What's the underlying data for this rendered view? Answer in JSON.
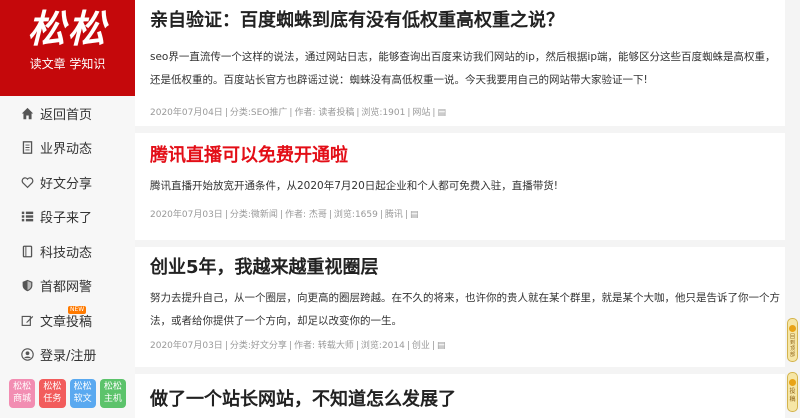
{
  "logo": {
    "big": "松松",
    "sub": "读文章 学知识"
  },
  "nav": [
    {
      "label": "返回首页",
      "icon": "home-icon"
    },
    {
      "label": "业界动态",
      "icon": "document-icon"
    },
    {
      "label": "好文分享",
      "icon": "heart-icon"
    },
    {
      "label": "段子来了",
      "icon": "list-icon"
    },
    {
      "label": "科技动态",
      "icon": "book-icon"
    },
    {
      "label": "首都网警",
      "icon": "shield-icon"
    },
    {
      "label": "文章投稿",
      "icon": "edit-icon",
      "badge": "NEW"
    },
    {
      "label": "登录/注册",
      "icon": "user-icon"
    }
  ],
  "apps": [
    {
      "line1": "松松",
      "line2": "商城",
      "color": "#f28db2"
    },
    {
      "line1": "松松",
      "line2": "任务",
      "color": "#f25c5c"
    },
    {
      "line1": "松松",
      "line2": "软文",
      "color": "#5aa9f0"
    },
    {
      "line1": "松松",
      "line2": "主机",
      "color": "#5cc36b"
    }
  ],
  "posts": [
    {
      "title": "亲自验证：百度蜘蛛到底有没有低权重高权重之说？",
      "excerpt": "seo界一直流传一个这样的说法，通过网站日志，能够查询出百度来访我们网站的ip，然后根据ip端，能够区分这些百度蜘蛛是高权重，还是低权重的。百度站长官方也辟谣过说：蜘蛛没有高低权重一说。今天我要用自己的网站带大家验证一下!",
      "date": "2020年07月04日",
      "category": "分类:SEO推广",
      "author": "作者: 读者投稿",
      "views": "浏览:1901",
      "tag": "网站"
    },
    {
      "title": "腾讯直播可以免费开通啦",
      "excerpt": "腾讯直播开始放宽开通条件，从2020年7月20日起企业和个人都可免费入驻，直播带货!",
      "date": "2020年07月03日",
      "category": "分类:微新闻",
      "author": "作者: 杰哥",
      "views": "浏览:1659",
      "tag": "腾讯"
    },
    {
      "title": "创业5年，我越来越重视圈层",
      "excerpt": "努力去提升自己，从一个圈层，向更高的圈层跨越。在不久的将来，也许你的贵人就在某个群里，就是某个大咖，他只是告诉了你一个方法，或者给你提供了一个方向，却足以改变你的一生。",
      "date": "2020年07月03日",
      "category": "分类:好文分享",
      "author": "作者: 转载大师",
      "views": "浏览:2014",
      "tag": "创业"
    },
    {
      "title": "做了一个站长网站，不知道怎么发展了"
    }
  ],
  "float_buttons": [
    {
      "label": "回到顶部"
    },
    {
      "label": "投稿"
    }
  ],
  "colors": {
    "brand_red": "#c5080b",
    "title_red": "#e30e17"
  }
}
